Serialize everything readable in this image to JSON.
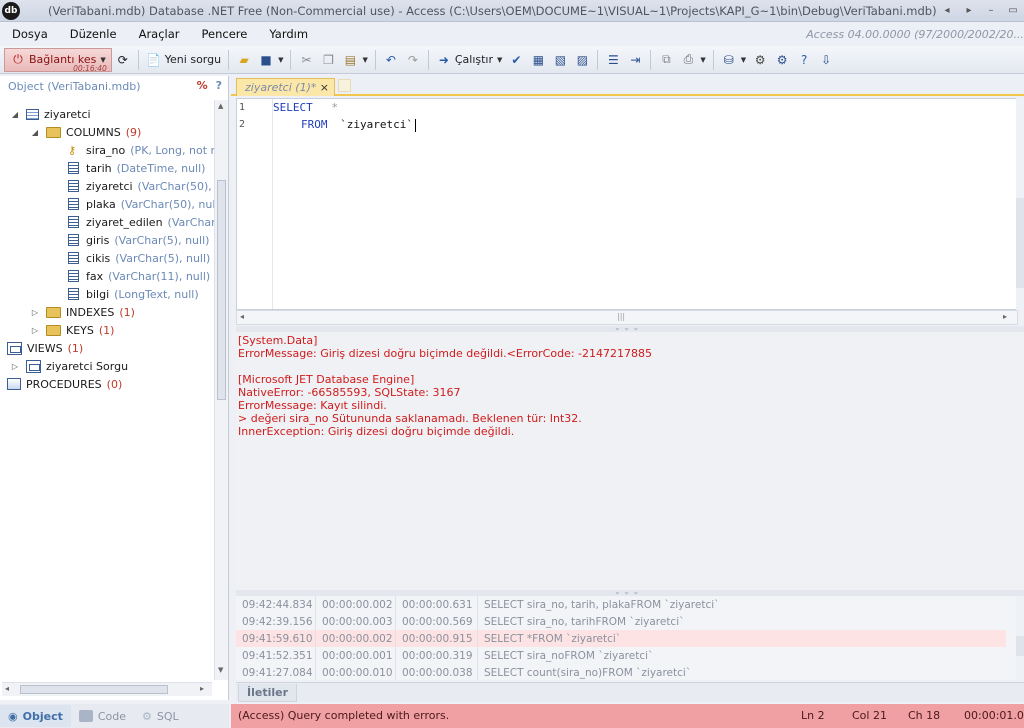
{
  "title": "(VeriTabani.mdb) Database .NET Free (Non-Commercial use) - Access (C:\\Users\\OEM\\DOCUME~1\\VISUAL~1\\Projects\\KAPI_G~1\\bin\\Debug\\VeriTabani.mdb)",
  "menu": [
    "Dosya",
    "Düzenle",
    "Araçlar",
    "Pencere",
    "Yardım"
  ],
  "access_version": "Access 04.00.0000 (97/2000/2002/20...",
  "toolbar": {
    "connect_label": "Bağlantı kes",
    "connect_time": "00:16:40",
    "new_query_label": "Yeni sorgu",
    "run_label": "Çalıştır"
  },
  "object_panel": {
    "title": "Object (VeriTabani.mdb)",
    "pct": "%",
    "help": "?",
    "table": "ziyaretci",
    "columns_label": "COLUMNS",
    "columns_count": "(9)",
    "columns": [
      {
        "name": "sira_no",
        "type": "(PK, Long, not nu"
      },
      {
        "name": "tarih",
        "type": "(DateTime, null)"
      },
      {
        "name": "ziyaretci",
        "type": "(VarChar(50), nu"
      },
      {
        "name": "plaka",
        "type": "(VarChar(50), null)"
      },
      {
        "name": "ziyaret_edilen",
        "type": "(VarChar(5"
      },
      {
        "name": "giris",
        "type": "(VarChar(5), null)"
      },
      {
        "name": "cikis",
        "type": "(VarChar(5), null)"
      },
      {
        "name": "fax",
        "type": "(VarChar(11), null)"
      },
      {
        "name": "bilgi",
        "type": "(LongText, null)"
      }
    ],
    "indexes_label": "INDEXES",
    "indexes_count": "(1)",
    "keys_label": "KEYS",
    "keys_count": "(1)",
    "views_label": "VIEWS",
    "views_count": "(1)",
    "view_item": "ziyaretci Sorgu",
    "procedures_label": "PROCEDURES",
    "procedures_count": "(0)"
  },
  "bottom_tabs": [
    "Object",
    "Code",
    "SQL"
  ],
  "doc_tab": "ziyaretci (1)*",
  "editor": {
    "line_numbers": [
      "1",
      "2"
    ],
    "kw_select": "SELECT",
    "star": "*",
    "kw_from": "FROM",
    "table_ref": "`ziyaretci`"
  },
  "messages": [
    "[System.Data]",
    "ErrorMessage: Giriş dizesi doğru biçimde değildi.<ErrorCode: -2147217885",
    "[Microsoft JET Database Engine]",
    "NativeError: -66585593, SQLState: 3167",
    "ErrorMessage: Kayıt silindi.",
    "> değeri sira_no Sütununda saklanamadı. Beklenen tür: Int32.",
    "InnerException: Giriş dizesi doğru biçimde değildi."
  ],
  "history": [
    {
      "time": "09:42:44.834",
      "d1": "00:00:00.002",
      "d2": "00:00:00.631",
      "sql": "SELECT sira_no, tarih, plakaFROM `ziyaretci`"
    },
    {
      "time": "09:42:39.156",
      "d1": "00:00:00.003",
      "d2": "00:00:00.569",
      "sql": "SELECT sira_no, tarihFROM `ziyaretci`"
    },
    {
      "time": "09:41:59.610",
      "d1": "00:00:00.002",
      "d2": "00:00:00.915",
      "sql": "SELECT *FROM `ziyaretci`"
    },
    {
      "time": "09:41:52.351",
      "d1": "00:00:00.001",
      "d2": "00:00:00.319",
      "sql": "SELECT sira_noFROM `ziyaretci`"
    },
    {
      "time": "09:41:27.084",
      "d1": "00:00:00.010",
      "d2": "00:00:00.038",
      "sql": "SELECT count(sira_no)FROM `ziyaretci`"
    }
  ],
  "messages_tab": "İletiler",
  "status": {
    "text": "(Access) Query completed with errors.",
    "ln": "Ln 2",
    "col": "Col 21",
    "ch": "Ch 18",
    "elapsed": "00:00:01.04"
  },
  "colors": {
    "status_error": "#f0a0a3",
    "message_error": "#d01b1b",
    "accent_tab": "#fbe8a8"
  }
}
